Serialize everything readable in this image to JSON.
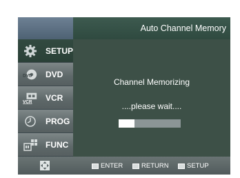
{
  "header": {
    "title": "Auto Channel Memory"
  },
  "sidebar": {
    "items": [
      {
        "label": "SETUP",
        "icon": "gear-icon",
        "active": true
      },
      {
        "label": "DVD",
        "icon": "dvd-icon",
        "icon_text": "DVD",
        "active": false
      },
      {
        "label": "VCR",
        "icon": "vcr-icon",
        "icon_text": "VCR",
        "active": false
      },
      {
        "label": "PROG",
        "icon": "clock-icon",
        "active": false
      },
      {
        "label": "FUNC",
        "icon": "function-icon",
        "active": false
      }
    ]
  },
  "main": {
    "message": "Channel Memorizing",
    "wait_text": "....please  wait....",
    "progress": 0.25
  },
  "footer": {
    "nav_icon": "navigation-pad-icon",
    "enter_label": "ENTER",
    "return_label": "RETURN",
    "setup_label": "SETUP"
  },
  "colors": {
    "screen_bg": "#3c5248",
    "active_tab": "#2f463c",
    "inactive_tab": "#6d7677",
    "progress_fill": "#ffffff",
    "progress_track": "#8b9596"
  }
}
